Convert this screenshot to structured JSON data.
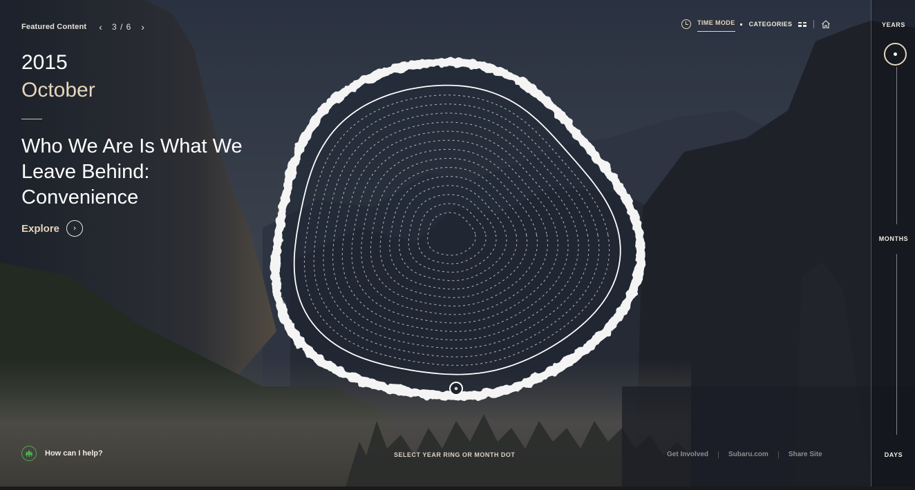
{
  "featured": {
    "label": "Featured Content",
    "prev_icon": "chevron-left-icon",
    "next_icon": "chevron-right-icon",
    "current": 3,
    "total": 6,
    "counter_text": "3 / 6"
  },
  "story": {
    "year": "2015",
    "month": "October",
    "headline": "Who We Are Is What We Leave Behind: Convenience",
    "explore_label": "Explore"
  },
  "topnav": {
    "time_mode": "TIME MODE",
    "categories": "CATEGORIES",
    "active": "TIME MODE",
    "icons": [
      "clock-icon",
      "grid-icon",
      "home-icon"
    ]
  },
  "timeline": {
    "years": "YEARS",
    "months": "MONTHS",
    "days": "DAYS",
    "selected": "YEARS"
  },
  "ring": {
    "dashed_ring_count": 14,
    "selected_marker": "month-dot"
  },
  "bottom": {
    "help_label": "How can I help?",
    "hint": "SELECT YEAR RING OR MONTH DOT",
    "links": [
      "Get Involved",
      "Subaru.com",
      "Share Site"
    ]
  },
  "colors": {
    "accent": "#e6d6bc",
    "help_green": "#4caf50",
    "text": "#ffffff",
    "footer_link": "#8d8d8f"
  }
}
